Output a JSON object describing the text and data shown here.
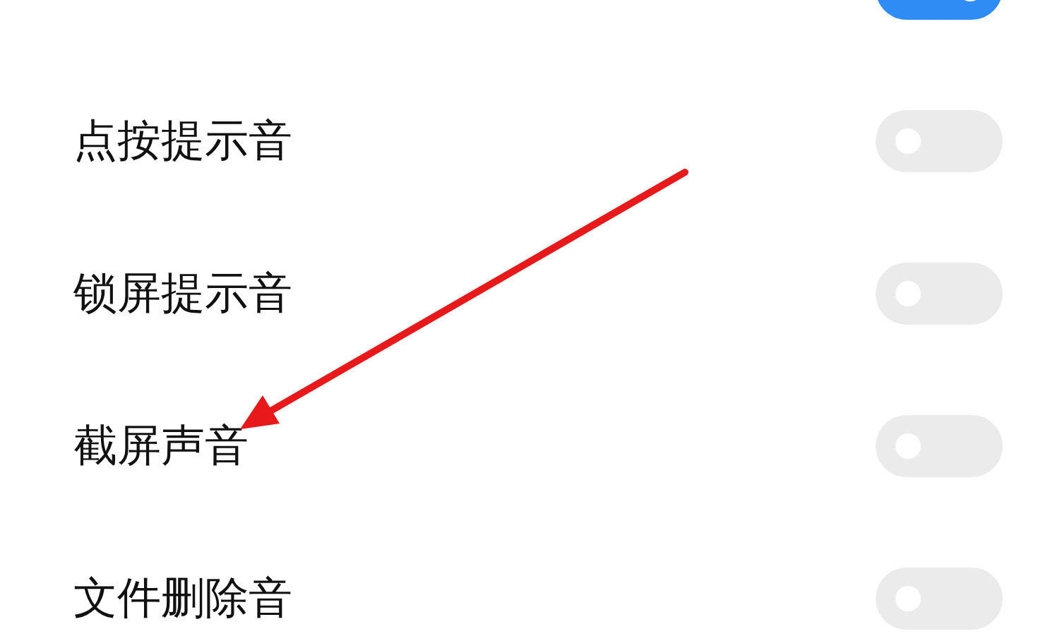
{
  "settings": [
    {
      "on": true
    },
    {
      "label": "点按提示音",
      "on": false
    },
    {
      "label": "锁屏提示音",
      "on": false
    },
    {
      "label": "截屏声音",
      "on": false
    },
    {
      "label": "文件删除音",
      "on": false
    }
  ]
}
